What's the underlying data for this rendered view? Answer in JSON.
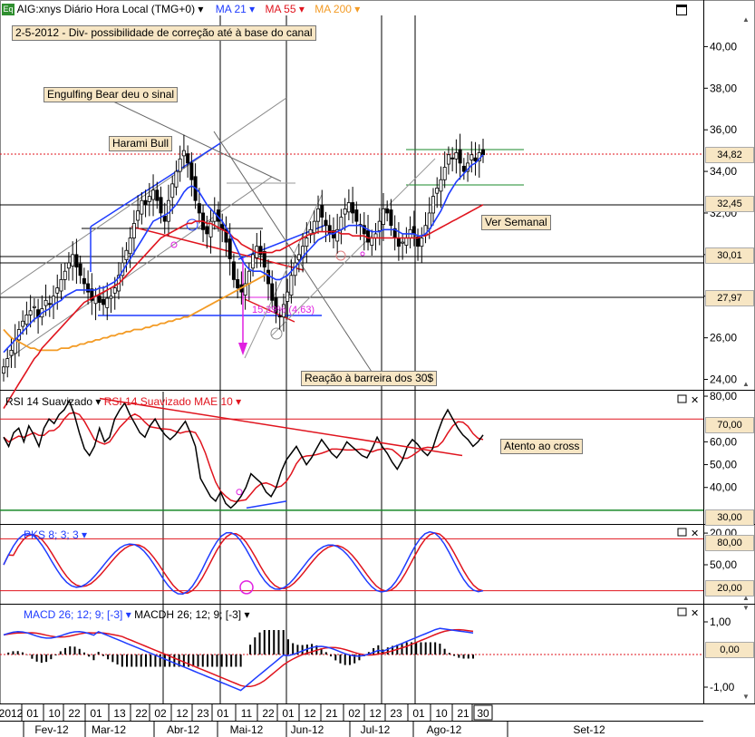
{
  "header": {
    "icon_text": "Eq",
    "instrument": "AIG:xnys Diário Hora Local (TMG+0)",
    "ma21": "MA 21",
    "ma55": "MA 55",
    "ma200": "MA 200"
  },
  "colors": {
    "up_candle": "#ffffff",
    "down_candle": "#000000",
    "ma21": "#1f3cff",
    "ma55": "#e0141e",
    "ma200": "#f39b25",
    "rsi": "#000000",
    "rsi_mae": "#e0141e",
    "pks_k": "#1f3cff",
    "pks_d": "#e0141e",
    "macd": "#1f3cff",
    "macd_signal": "#e0141e",
    "annotation_magenta": "#e020e0",
    "note_bg": "#f7e6c4",
    "trend_red": "#e0141e",
    "trend_blue": "#1f3cff",
    "green_level": "#1a8a2a"
  },
  "annotations": {
    "title_note": "2-5-2012 - Div- possibilidade de correção até à base do canal",
    "engulfing": "Engulfing Bear deu o sinal",
    "harami": "Harami Bull",
    "ver_semanal": "Ver Semanal",
    "reacao": "Reação à barreira dos 30$",
    "atento": "Atento ao cross",
    "fib_label": "15,39% (4,63)"
  },
  "price_axis": {
    "ticks": [
      "40,00",
      "38,00",
      "36,00",
      "34,00",
      "32,00",
      "30,00",
      "28,00",
      "26,00",
      "24,00"
    ],
    "tags": [
      "34,82",
      "32,45",
      "30,01",
      "27,97"
    ]
  },
  "rsi_panel": {
    "title": "RSI 14 Suavizado",
    "title2": "RSI 14 Suavizado MAE 10",
    "ticks": [
      "80,00",
      "60,00",
      "50,00",
      "40,00",
      "20,00"
    ],
    "tags": [
      "70,00",
      "30,00"
    ]
  },
  "pks_panel": {
    "title": "PKS 8; 3; 3",
    "ticks": [
      "50,00"
    ],
    "tags": [
      "80,00",
      "20,00"
    ]
  },
  "macd_panel": {
    "title": "MACD 26; 12; 9; [-3]",
    "title2": "MACDH 26; 12; 9; [-3]",
    "ticks": [
      "1,00",
      "-1,00"
    ],
    "tags": [
      "0,00"
    ]
  },
  "x_axis": {
    "days": [
      "2012",
      "01",
      "10",
      "22",
      "01",
      "13",
      "22",
      "02",
      "12",
      "23",
      "01",
      "11",
      "22",
      "01",
      "12",
      "21",
      "02",
      "12",
      "23",
      "01",
      "10",
      "21",
      "30"
    ],
    "months": [
      "Fev-12",
      "Mar-12",
      "Abr-12",
      "Mai-12",
      "Jun-12",
      "Jul-12",
      "Ago-12",
      "Set-12"
    ]
  },
  "chart_data": {
    "type": "candlestick",
    "price": {
      "ylim": [
        23.5,
        41.5
      ],
      "closes": [
        24.6,
        25.0,
        25.4,
        25.9,
        26.4,
        26.8,
        27.1,
        27.3,
        27.5,
        27.0,
        27.4,
        27.8,
        27.6,
        28.0,
        28.4,
        28.8,
        29.2,
        29.6,
        30.0,
        29.4,
        29.0,
        28.6,
        28.2,
        27.8,
        28.0,
        27.7,
        27.6,
        27.9,
        28.0,
        28.4,
        29.0,
        29.6,
        30.2,
        30.8,
        31.5,
        32.1,
        32.6,
        32.4,
        32.8,
        33.1,
        32.6,
        32.0,
        31.6,
        32.6,
        33.4,
        34.0,
        34.6,
        35.0,
        34.4,
        33.6,
        32.6,
        32.0,
        31.2,
        31.0,
        31.6,
        32.0,
        31.6,
        31.2,
        30.6,
        29.8,
        28.8,
        28.4,
        28.2,
        28.6,
        29.2,
        30.0,
        30.4,
        30.0,
        29.4,
        28.6,
        27.8,
        27.2,
        27.0,
        27.6,
        28.2,
        29.0,
        29.6,
        30.0,
        30.4,
        30.8,
        31.2,
        31.6,
        32.2,
        31.8,
        31.4,
        31.0,
        30.8,
        31.2,
        31.8,
        32.2,
        32.5,
        32.0,
        31.6,
        31.4,
        31.0,
        30.6,
        30.8,
        31.0,
        31.6,
        32.2,
        32.0,
        31.4,
        30.8,
        30.4,
        30.6,
        30.8,
        31.2,
        31.0,
        30.4,
        30.8,
        31.4,
        32.0,
        32.8,
        33.2,
        33.6,
        34.2,
        34.8,
        34.6,
        34.9,
        34.4,
        34.0,
        34.4,
        34.8,
        34.5,
        34.9,
        34.8
      ],
      "ma21": [
        25.3,
        25.5,
        25.7,
        25.9,
        26.1,
        26.3,
        26.5,
        26.7,
        26.9,
        27.0,
        27.2,
        27.3,
        27.4,
        27.6,
        27.7,
        27.8,
        28.0,
        28.1,
        28.2,
        28.3,
        28.3,
        28.3,
        28.3,
        28.3,
        28.3,
        28.4,
        28.4,
        28.5,
        28.6,
        28.7,
        28.9,
        29.2,
        29.5,
        29.8,
        30.1,
        30.4,
        30.7,
        31.0,
        31.3,
        31.6,
        31.7,
        31.8,
        31.9,
        32.0,
        32.2,
        32.4,
        32.7,
        33.0,
        33.2,
        33.3,
        33.2,
        33.0,
        32.7,
        32.4,
        32.2,
        32.0,
        31.8,
        31.6,
        31.3,
        31.0,
        30.6,
        30.2,
        29.8,
        29.5,
        29.3,
        29.2,
        29.2,
        29.2,
        29.1,
        29.0,
        28.9,
        28.8,
        28.8,
        28.9,
        29.0,
        29.2,
        29.4,
        29.6,
        29.9,
        30.1,
        30.3,
        30.5,
        30.7,
        30.8,
        30.9,
        31.0,
        31.0,
        31.1,
        31.2,
        31.3,
        31.4,
        31.4,
        31.4,
        31.4,
        31.3,
        31.2,
        31.1,
        31.1,
        31.1,
        31.2,
        31.2,
        31.2,
        31.2,
        31.1,
        31.0,
        31.0,
        31.0,
        31.0,
        30.9,
        30.9,
        31.0,
        31.2,
        31.5,
        31.8,
        32.1,
        32.5,
        32.9,
        33.2,
        33.5,
        33.7,
        33.9,
        34.1,
        34.3,
        34.4,
        34.6,
        34.8
      ],
      "ma55": [
        22.6,
        22.9,
        23.2,
        23.5,
        23.8,
        24.1,
        24.4,
        24.7,
        25.0,
        25.2,
        25.5,
        25.7,
        25.9,
        26.1,
        26.3,
        26.5,
        26.7,
        26.9,
        27.1,
        27.3,
        27.5,
        27.7,
        27.8,
        27.9,
        28.0,
        28.1,
        28.2,
        28.3,
        28.4,
        28.5,
        28.6,
        28.8,
        29.0,
        29.2,
        29.4,
        29.6,
        29.8,
        30.0,
        30.2,
        30.4,
        30.6,
        30.8,
        30.9,
        31.0,
        31.1,
        31.2,
        31.3,
        31.4,
        31.5,
        31.5,
        31.6,
        31.6,
        31.6,
        31.5,
        31.5,
        31.4,
        31.3,
        31.2,
        31.1,
        31.0,
        30.8,
        30.7,
        30.5,
        30.4,
        30.3,
        30.2,
        30.1,
        30.1,
        30.1,
        30.1,
        30.1,
        30.2,
        30.2,
        30.3,
        30.4,
        30.5,
        30.6,
        30.7,
        30.8,
        30.9,
        31.0,
        31.0,
        31.1,
        31.1,
        31.1,
        31.1,
        31.1,
        31.1,
        31.0,
        31.0,
        31.0,
        30.9,
        30.9,
        30.9,
        30.9,
        30.8,
        30.8,
        30.8,
        30.8,
        30.8,
        30.8,
        30.8,
        30.8,
        30.8,
        30.8,
        30.8,
        30.8,
        30.8,
        30.8,
        30.9,
        30.9,
        31.0,
        31.1,
        31.2,
        31.3,
        31.4,
        31.5,
        31.6,
        31.7,
        31.8,
        31.9,
        32.0,
        32.1,
        32.2,
        32.3,
        32.4
      ],
      "ma200": [
        26.4,
        26.2,
        26.0,
        25.9,
        25.8,
        25.7,
        25.6,
        25.5,
        25.5,
        25.4,
        25.4,
        25.4,
        25.4,
        25.4,
        25.4,
        25.5,
        25.5,
        25.5,
        25.6,
        25.6,
        25.7,
        25.7,
        25.8,
        25.8,
        25.9,
        25.9,
        26.0,
        26.0,
        26.1,
        26.1,
        26.2,
        26.2,
        26.3,
        26.3,
        26.4,
        26.4,
        26.4,
        26.5,
        26.5,
        26.6,
        26.6,
        26.7,
        26.7,
        26.8,
        26.8,
        26.9,
        26.9,
        27.0,
        27.0,
        27.1,
        27.2,
        27.3,
        27.4,
        27.5,
        27.6,
        27.7,
        27.8,
        27.9,
        28.0,
        28.1,
        28.2,
        28.3,
        28.4,
        28.5,
        28.6,
        28.7,
        28.8,
        28.9,
        29.0,
        29.1
      ]
    },
    "rsi": {
      "ylim": [
        24,
        82
      ]
    },
    "pks": {
      "ylim": [
        5,
        95
      ]
    },
    "macd": {
      "ylim": [
        -1.5,
        1.5
      ]
    }
  }
}
